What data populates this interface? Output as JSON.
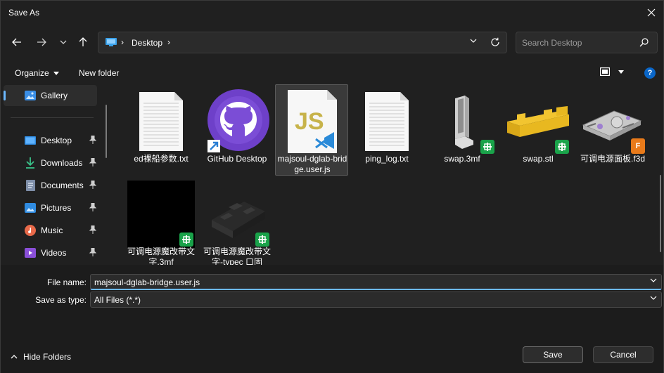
{
  "window": {
    "title": "Save As"
  },
  "address": {
    "location": "Desktop"
  },
  "search": {
    "placeholder": "Search Desktop"
  },
  "toolbar": {
    "organize_label": "Organize",
    "new_folder_label": "New folder"
  },
  "sidebar": {
    "items": [
      {
        "label": "Gallery",
        "icon": "gallery-icon"
      },
      {
        "label": "Desktop",
        "icon": "desktop-icon"
      },
      {
        "label": "Downloads",
        "icon": "downloads-icon"
      },
      {
        "label": "Documents",
        "icon": "documents-icon"
      },
      {
        "label": "Pictures",
        "icon": "pictures-icon"
      },
      {
        "label": "Music",
        "icon": "music-icon"
      },
      {
        "label": "Videos",
        "icon": "videos-icon"
      }
    ]
  },
  "files": [
    {
      "name": "ed裸船参数.txt",
      "type": "text-file"
    },
    {
      "name": "GitHub Desktop",
      "type": "shortcut"
    },
    {
      "name": "majsoul-dglab-bridge.user.js",
      "type": "js-file",
      "selected": true
    },
    {
      "name": "ping_log.txt",
      "type": "text-file"
    },
    {
      "name": "swap.3mf",
      "type": "3mf-model"
    },
    {
      "name": "swap.stl",
      "type": "stl-model"
    },
    {
      "name": "可调电源面板.f3d",
      "type": "f3d-model"
    },
    {
      "name": "可调电源魔改带文字.3mf",
      "type": "3mf-model"
    },
    {
      "name": "可调电源魔改带文字-typec 口固",
      "type": "3mf-model"
    }
  ],
  "form": {
    "file_name_label": "File name:",
    "file_name_value": "majsoul-dglab-bridge.user.js",
    "save_as_type_label": "Save as type:",
    "save_as_type_value": "All Files (*.*)"
  },
  "footer": {
    "hide_folders_label": "Hide Folders",
    "save_label": "Save",
    "cancel_label": "Cancel"
  },
  "colors": {
    "accent": "#6cb8ff",
    "help_blue": "#0a66c8",
    "badge_green": "#1aa34a",
    "js_yellow": "#c7b34a",
    "github_purple": "#6e40c9"
  }
}
